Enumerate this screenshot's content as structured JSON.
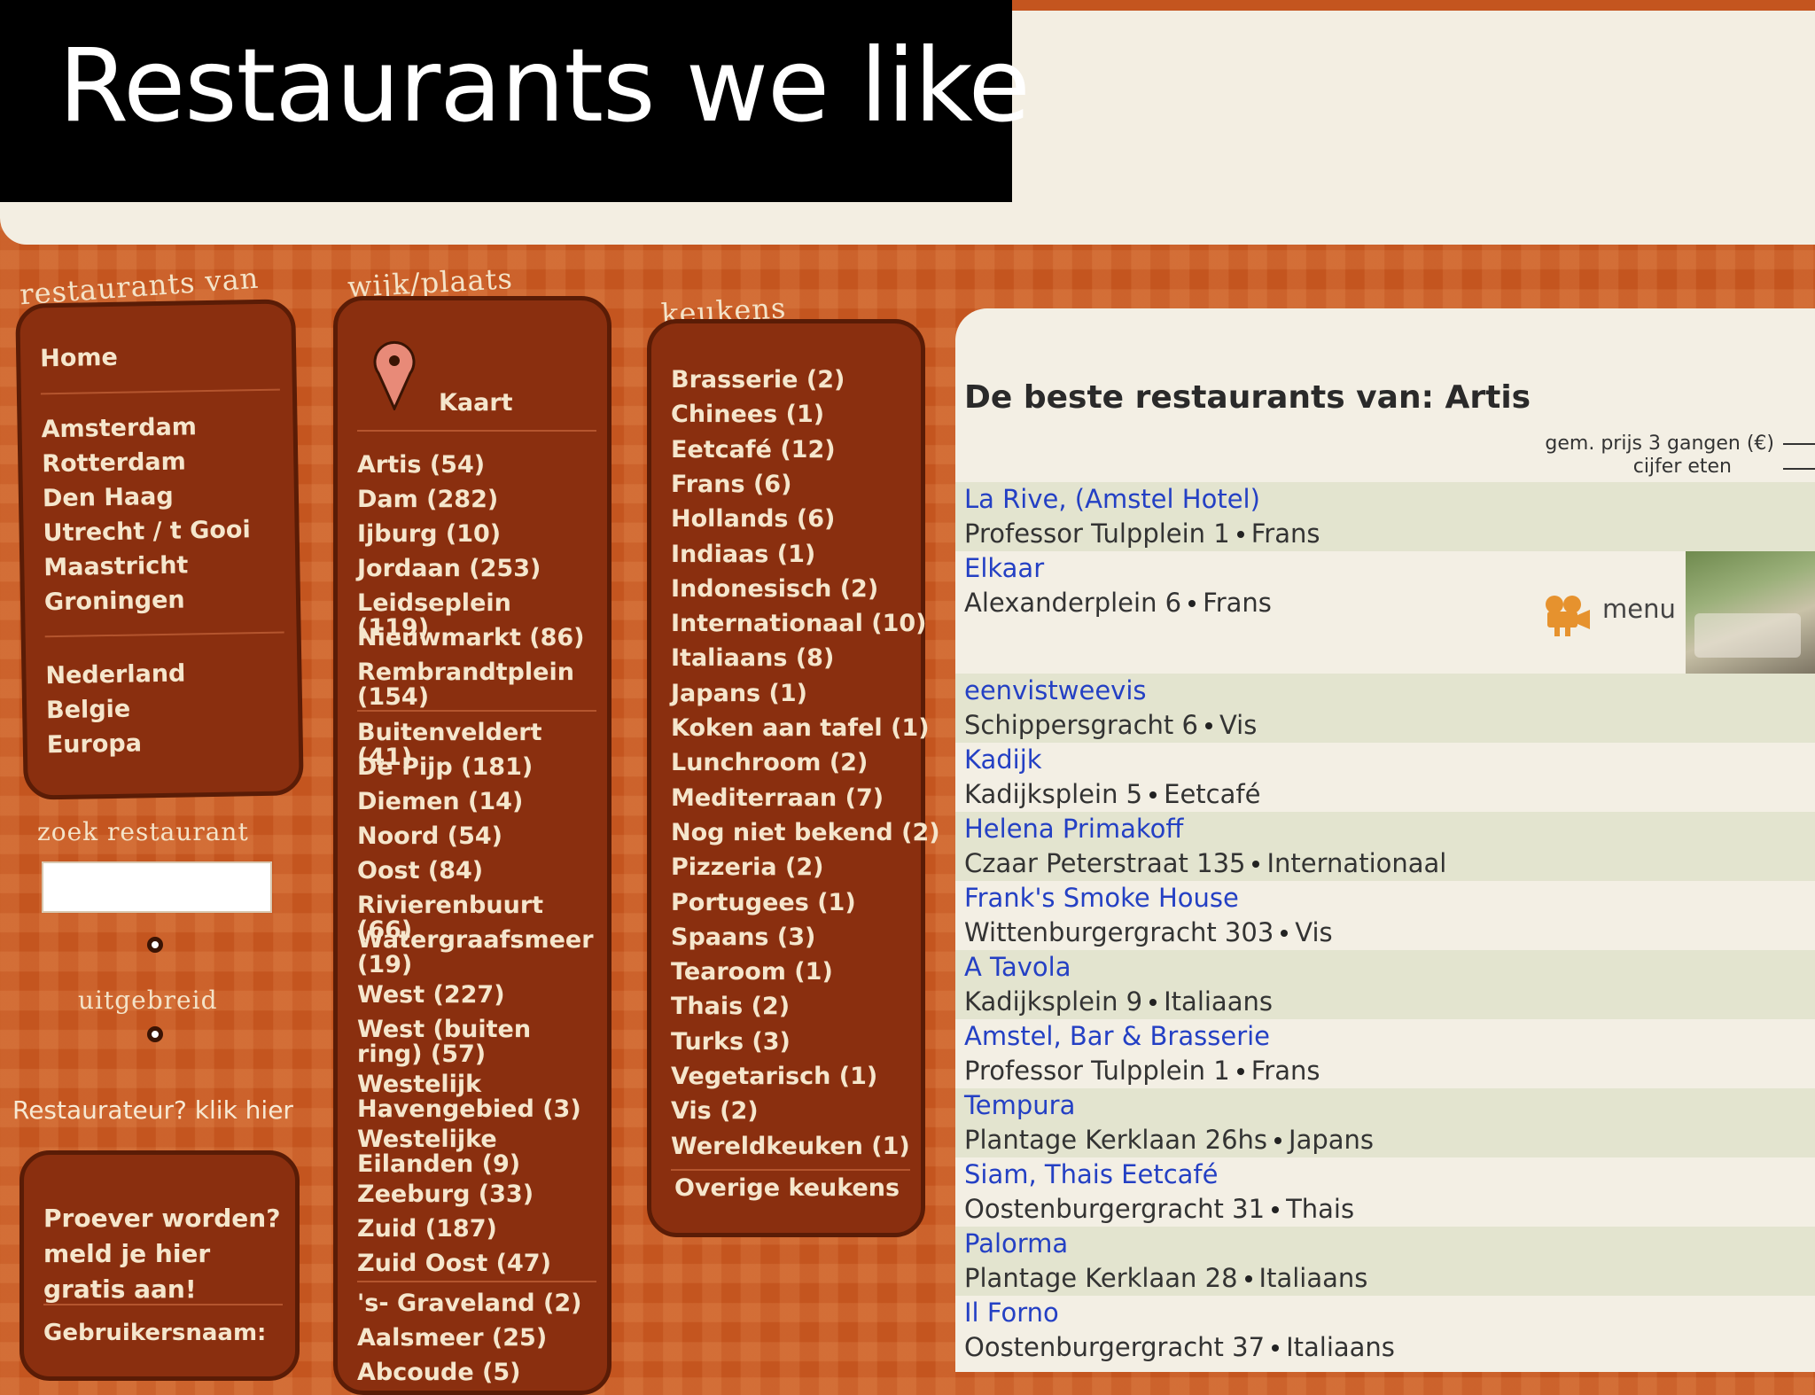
{
  "slide_title": "Restaurants we like",
  "sidebar": {
    "heading": "restaurants van",
    "group1": [
      "Home"
    ],
    "group2": [
      "Amsterdam",
      "Rotterdam",
      "Den Haag",
      "Utrecht / t Gooi",
      "Maastricht",
      "Groningen"
    ],
    "group3": [
      "Nederland",
      "Belgie",
      "Europa"
    ],
    "search_heading": "zoek restaurant",
    "search_value": "",
    "advanced_label": "uitgebreid",
    "restaurateur_link": "Restaurateur? klik hier",
    "login_promo": "Proever worden? meld je hier gratis aan!",
    "username_label": "Gebruikersnaam:"
  },
  "wijk": {
    "heading": "wijk/plaats",
    "map_label": "Kaart",
    "list1": [
      "Artis (54)",
      "Dam (282)",
      "Ijburg (10)",
      "Jordaan (253)",
      "Leidseplein (119)",
      "Nieuwmarkt (86)",
      "Rembrandtplein (154)"
    ],
    "list2": [
      "Buitenveldert (41)",
      "De Pijp (181)",
      "Diemen (14)",
      "Noord (54)",
      "Oost (84)",
      "Rivierenbuurt (66)",
      "Watergraafsmeer (19)",
      "West (227)",
      "West (buiten ring) (57)",
      "Westelijk Havengebied (3)",
      "Westelijke Eilanden (9)",
      "Zeeburg (33)",
      "Zuid (187)",
      "Zuid Oost (47)"
    ],
    "list3": [
      "'s- Graveland (2)",
      "Aalsmeer (25)",
      "Abcoude (5)"
    ]
  },
  "keukens": {
    "heading": "keukens",
    "items": [
      "Brasserie (2)",
      "Chinees (1)",
      "Eetcafé (12)",
      "Frans (6)",
      "Hollands (6)",
      "Indiaas (1)",
      "Indonesisch (2)",
      "Internationaal (10)",
      "Italiaans (8)",
      "Japans (1)",
      "Koken aan tafel (1)",
      "Lunchroom (2)",
      "Mediterraan (7)",
      "Nog niet bekend (2)",
      "Pizzeria (2)",
      "Portugees (1)",
      "Spaans (3)",
      "Tearoom (1)",
      "Thais (2)",
      "Turks (3)",
      "Vegetarisch (1)",
      "Vis (2)",
      "Wereldkeuken (1)"
    ],
    "other": "Overige keukens"
  },
  "content": {
    "title": "De beste restaurants van: Artis",
    "legend_price": "gem. prijs 3 gangen (€)",
    "legend_score": "cijfer eten",
    "menu_label": "menu",
    "restaurants": [
      {
        "name": "La Rive, (Amstel Hotel)",
        "address": "Professor Tulpplein 1",
        "cuisine": "Frans"
      },
      {
        "name": "Elkaar",
        "address": "Alexanderplein 6",
        "cuisine": "Frans"
      },
      {
        "name": "eenvistweevis",
        "address": "Schippersgracht 6",
        "cuisine": "Vis"
      },
      {
        "name": "Kadijk",
        "address": "Kadijksplein 5",
        "cuisine": "Eetcafé"
      },
      {
        "name": "Helena Primakoff",
        "address": "Czaar Peterstraat 135",
        "cuisine": "Internationaal"
      },
      {
        "name": "Frank's Smoke House",
        "address": "Wittenburgergracht 303",
        "cuisine": "Vis"
      },
      {
        "name": "A Tavola",
        "address": "Kadijksplein 9",
        "cuisine": "Italiaans"
      },
      {
        "name": "Amstel, Bar & Brasserie",
        "address": "Professor Tulpplein 1",
        "cuisine": "Frans"
      },
      {
        "name": "Tempura",
        "address": "Plantage Kerklaan 26hs",
        "cuisine": "Japans"
      },
      {
        "name": "Siam, Thais Eetcafé",
        "address": "Oostenburgergracht 31",
        "cuisine": "Thais"
      },
      {
        "name": "Palorma",
        "address": "Plantage Kerklaan 28",
        "cuisine": "Italiaans"
      },
      {
        "name": "Il Forno",
        "address": "Oostenburgergracht 37",
        "cuisine": "Italiaans"
      }
    ]
  },
  "colors": {
    "background": "#c4551f",
    "panel": "#8a2f0f",
    "link_blue": "#2440c4",
    "row_band": "#e3e4cf"
  }
}
